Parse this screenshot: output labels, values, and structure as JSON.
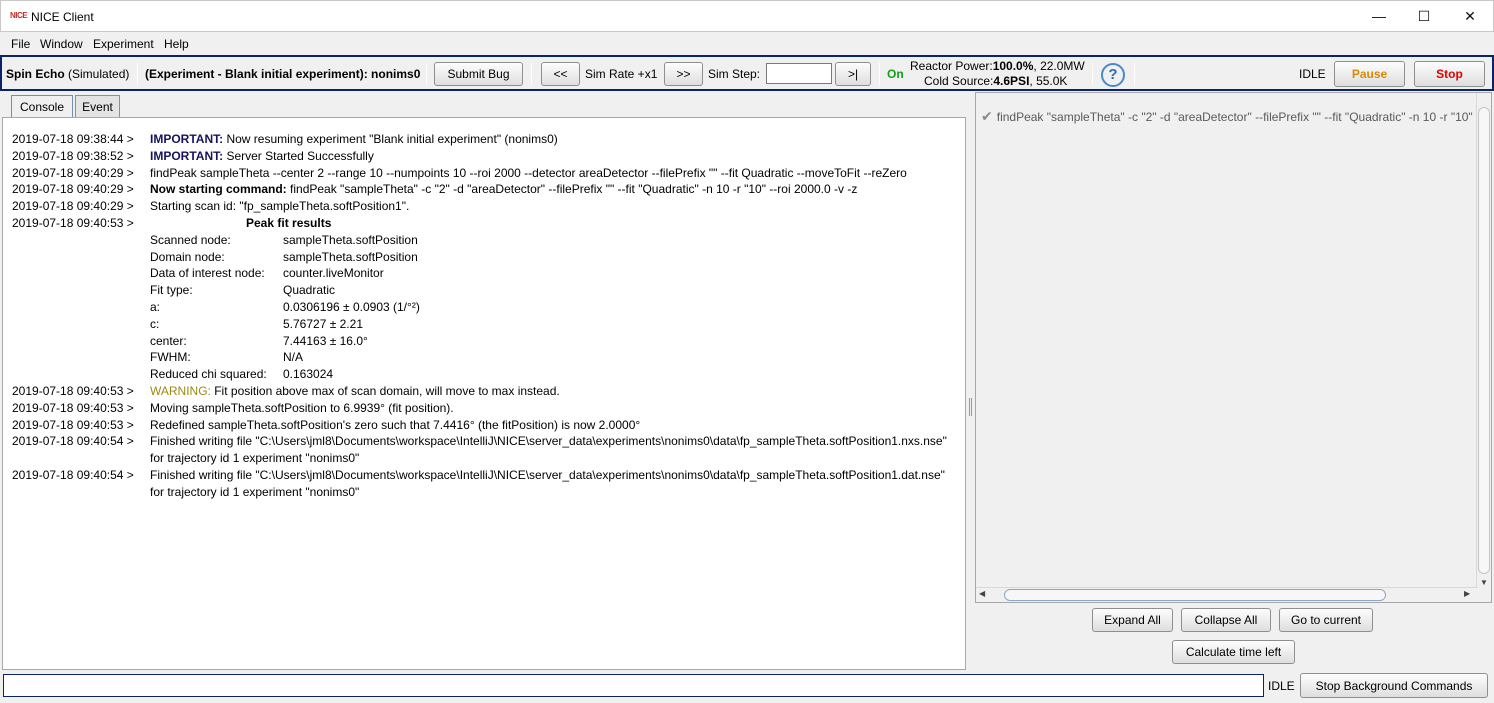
{
  "window": {
    "title": "NICE Client",
    "icon": "NICE",
    "minimize": "—",
    "maximize": "☐",
    "close": "✕"
  },
  "menu": [
    "File",
    "Window",
    "Experiment",
    "Help"
  ],
  "toolbar": {
    "instrument": "Spin Echo",
    "instrument_mode": "(Simulated)",
    "experiment": "(Experiment - Blank initial experiment): nonims0",
    "submit_bug": "Submit Bug",
    "rewind": "<<",
    "sim_rate_label": "Sim Rate +x1",
    "fast_forward": ">>",
    "sim_step_label": "Sim Step:",
    "sim_step_value": "",
    "step_end": ">|",
    "on_status": "On",
    "on_color": "#12a012",
    "reactor_power_label": "Reactor Power:",
    "reactor_power_value": "100.0%",
    "reactor_power_mw": ", 22.0MW",
    "cold_source_label": "Cold Source:",
    "cold_source_value": "4.6PSI",
    "cold_source_temp": ", 55.0K",
    "help": "?",
    "status": "IDLE",
    "pause": "Pause",
    "pause_color": "#d88a00",
    "stop": "Stop",
    "stop_color": "#e00000"
  },
  "tabs": [
    "Console",
    "Event"
  ],
  "log": [
    {
      "ts": "2019-07-18 09:38:44 >",
      "prefix": "IMPORTANT:",
      "prefix_style": "important",
      "text": " Now resuming experiment \"Blank initial experiment\" (nonims0)"
    },
    {
      "ts": "2019-07-18 09:38:52 >",
      "prefix": "IMPORTANT:",
      "prefix_style": "important",
      "text": " Server Started Successfully"
    },
    {
      "ts": "2019-07-18 09:40:29 >",
      "prefix": "",
      "prefix_style": "",
      "text": "findPeak sampleTheta --center 2 --range 10 --numpoints 10 --roi 2000 --detector areaDetector --filePrefix \"\" --fit Quadratic --moveToFit --reZero"
    },
    {
      "ts": "2019-07-18 09:40:29 >",
      "prefix": "Now starting command:",
      "prefix_style": "bold",
      "text": " findPeak \"sampleTheta\" -c \"2\" -d \"areaDetector\" --filePrefix \"\" --fit \"Quadratic\" -n 10 -r \"10\" --roi 2000.0 -v -z"
    },
    {
      "ts": "2019-07-18 09:40:29 >",
      "prefix": "",
      "prefix_style": "",
      "text": "Starting scan id: \"fp_sampleTheta.softPosition1\"."
    }
  ],
  "fit": {
    "ts": "2019-07-18 09:40:53 >",
    "title": "Peak fit results",
    "rows": [
      {
        "key": "Scanned node:",
        "value": "sampleTheta.softPosition"
      },
      {
        "key": "Domain node:",
        "value": "sampleTheta.softPosition"
      },
      {
        "key": "Data of interest node:",
        "value": "counter.liveMonitor"
      },
      {
        "key": "Fit type:",
        "value": "Quadratic"
      },
      {
        "key": "a:",
        "value": "0.0306196 ± 0.0903 (1/°²)"
      },
      {
        "key": "c:",
        "value": "5.76727 ± 2.21"
      },
      {
        "key": "center:",
        "value": "7.44163 ± 16.0°"
      },
      {
        "key": "FWHM:",
        "value": "N/A"
      },
      {
        "key": "Reduced chi squared:",
        "value": "0.163024"
      }
    ]
  },
  "log2": [
    {
      "ts": "2019-07-18 09:40:53 >",
      "prefix": "WARNING:",
      "prefix_style": "warning",
      "text": " Fit position above max of scan domain, will move to max instead."
    },
    {
      "ts": "2019-07-18 09:40:53 >",
      "prefix": "",
      "prefix_style": "",
      "text": "Moving sampleTheta.softPosition to 6.9939° (fit position)."
    },
    {
      "ts": "2019-07-18 09:40:53 >",
      "prefix": "",
      "prefix_style": "",
      "text": "Redefined sampleTheta.softPosition's zero such that 7.4416° (the fitPosition) is now 2.0000°"
    },
    {
      "ts": "2019-07-18 09:40:54 >",
      "prefix": "",
      "prefix_style": "",
      "text": "Finished writing file \"C:\\Users\\jml8\\Documents\\workspace\\IntelliJ\\NICE\\server_data\\experiments\\nonims0\\data\\fp_sampleTheta.softPosition1.nxs.nse\" for trajectory id 1 experiment \"nonims0\""
    },
    {
      "ts": "2019-07-18 09:40:54 >",
      "prefix": "",
      "prefix_style": "",
      "text": "Finished writing file \"C:\\Users\\jml8\\Documents\\workspace\\IntelliJ\\NICE\\server_data\\experiments\\nonims0\\data\\fp_sampleTheta.softPosition1.dat.nse\" for trajectory id 1 experiment \"nonims0\""
    }
  ],
  "queue": {
    "item": "findPeak \"sampleTheta\" -c \"2\" -d \"areaDetector\" --filePrefix \"\" --fit \"Quadratic\" -n 10 -r \"10\"",
    "check_icon": "✔",
    "expand_all": "Expand All",
    "collapse_all": "Collapse All",
    "go_to_current": "Go to current",
    "calc_time_left": "Calculate time left"
  },
  "statusbar": {
    "command_value": "",
    "status": "IDLE",
    "stop_background": "Stop Background Commands"
  }
}
